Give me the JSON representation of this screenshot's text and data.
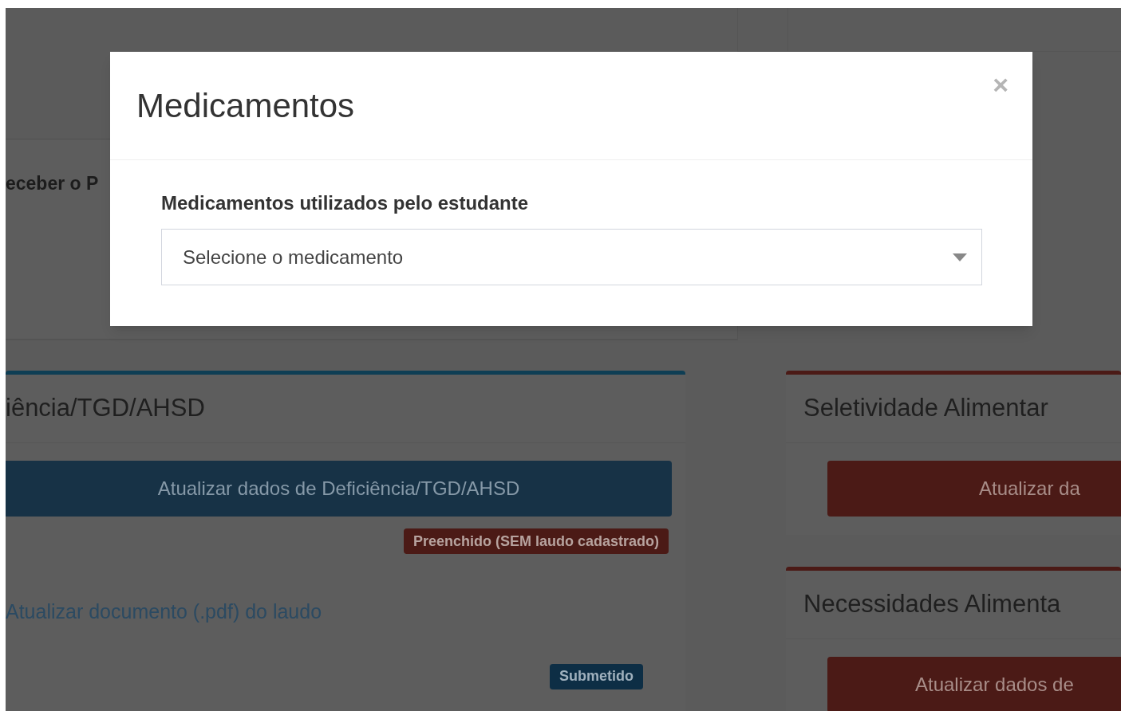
{
  "background": {
    "top_text": "eceber o P",
    "left_card": {
      "title": "iência/TGD/AHSD",
      "button": "Atualizar dados de Deficiência/TGD/AHSD",
      "status_badge": "Preenchido (SEM laudo cadastrado)",
      "link": "Atualizar documento (.pdf) do laudo",
      "upload_badge": "Submetido"
    },
    "right_cards": [
      {
        "title": "Seletividade Alimentar",
        "button": "Atualizar da"
      },
      {
        "title": "Necessidades Alimenta",
        "button": "Atualizar dados de"
      }
    ]
  },
  "modal": {
    "title": "Medicamentos",
    "close": "×",
    "field_label": "Medicamentos utilizados pelo estudante",
    "select": {
      "placeholder": "Selecione o medicamento"
    }
  }
}
